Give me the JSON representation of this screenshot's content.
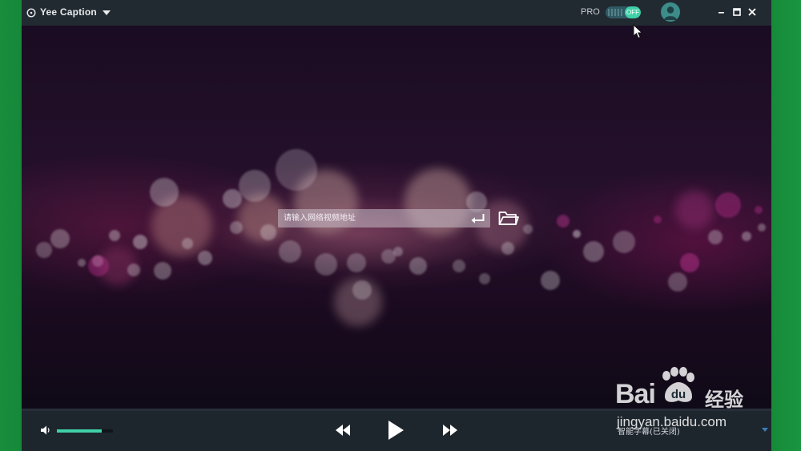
{
  "app": {
    "title": "Yee Caption",
    "pro_label": "PRO",
    "pro_toggle_state": "OFF"
  },
  "main": {
    "url_placeholder": "请输入网络视频地址",
    "url_value": ""
  },
  "player": {
    "volume_level": 0.8,
    "caption_status": "智能字幕(已关闭)"
  },
  "watermark": {
    "brand": "Bai",
    "brand_suffix": "经验",
    "url": "jingyan.baidu.com"
  },
  "colors": {
    "accent": "#3fd0a8",
    "titlebar": "#222a31",
    "controlbar": "#1e262d",
    "desktop": "#1b8a3a"
  },
  "icons": [
    "logo-icon",
    "chevron-down-icon",
    "avatar-icon",
    "minimize-icon",
    "maximize-icon",
    "close-icon",
    "enter-icon",
    "folder-open-icon",
    "volume-icon",
    "rewind-icon",
    "play-icon",
    "fast-forward-icon",
    "mouse-cursor-icon"
  ]
}
